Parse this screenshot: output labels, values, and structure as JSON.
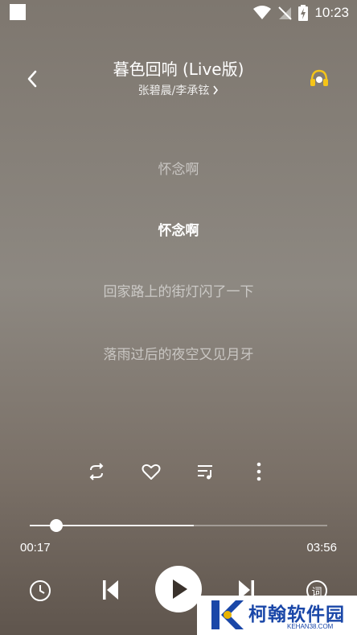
{
  "status_bar": {
    "time": "10:23"
  },
  "header": {
    "title": "暮色回响 (Live版)",
    "artist": "张碧晨/李承铉"
  },
  "lyrics": [
    {
      "text": "怀念啊",
      "active": false
    },
    {
      "text": "怀念啊",
      "active": true
    },
    {
      "text": "回家路上的街灯闪了一下",
      "active": false
    },
    {
      "text": "落雨过后的夜空又见月牙",
      "active": false
    }
  ],
  "player": {
    "elapsed": "00:17",
    "duration": "03:56",
    "progress_fraction": 0.088,
    "buffered_fraction": 0.55
  },
  "lyrics_button_label": "词",
  "watermark": {
    "brand": "柯翰软件园",
    "domain": "KEHAN38.COM"
  },
  "colors": {
    "brand_blue": "#1a47a8"
  }
}
